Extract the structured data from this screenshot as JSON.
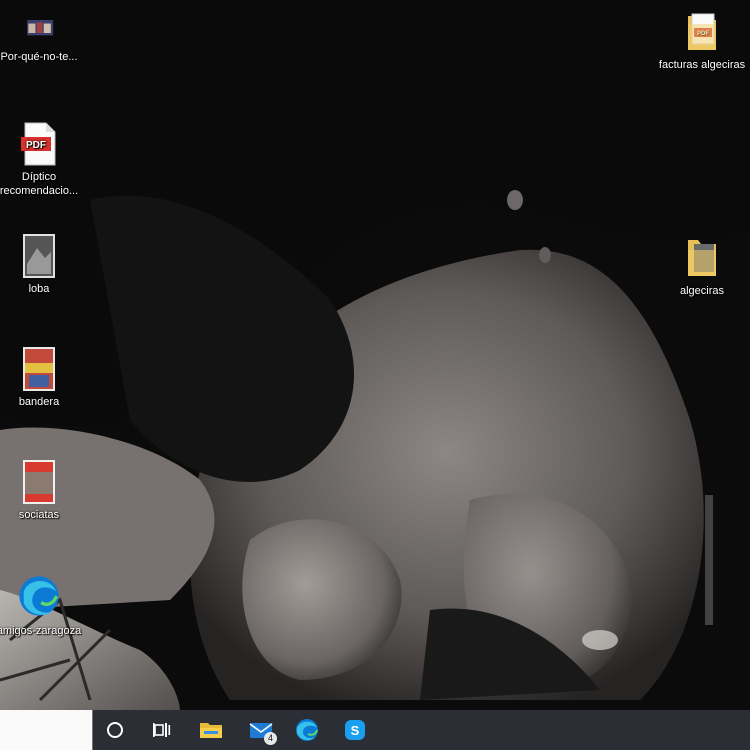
{
  "desktop_icons": [
    {
      "name": "video-thumbnail",
      "label": "Por-qué-no-te..."
    },
    {
      "name": "pdf-file",
      "label_line1": "Díptico",
      "label_line2": "recomendacio..."
    },
    {
      "name": "image-file",
      "label": "loba"
    },
    {
      "name": "image-file",
      "label": "bandera"
    },
    {
      "name": "image-file",
      "label": "sociatas"
    },
    {
      "name": "edge-shortcut",
      "label": "amigos-zaragoza"
    },
    {
      "name": "pdf-folder",
      "label": "facturas algeciras"
    },
    {
      "name": "folder",
      "label": "algeciras"
    }
  ],
  "taskbar": {
    "mail_badge": "4"
  },
  "colors": {
    "taskbar": "#2b2f35",
    "folder": "#e8c05a",
    "pdf_red": "#d8302b",
    "edge_blue": "#0c7bd6",
    "skype": "#1a9ff0"
  }
}
